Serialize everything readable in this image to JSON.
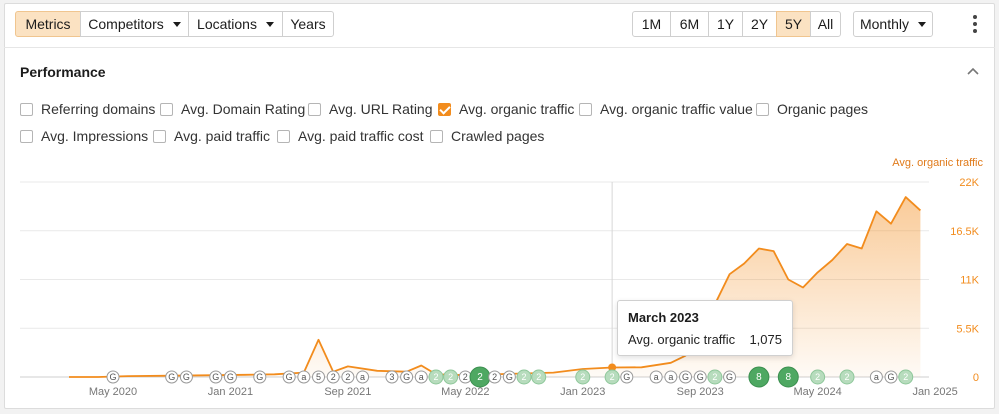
{
  "toolbar": {
    "left_buttons": [
      {
        "label": "Metrics",
        "active": true,
        "dropdown": false
      },
      {
        "label": "Competitors",
        "active": false,
        "dropdown": true
      },
      {
        "label": "Locations",
        "active": false,
        "dropdown": true
      },
      {
        "label": "Years",
        "active": false,
        "dropdown": false
      }
    ],
    "ranges": [
      {
        "label": "1M",
        "active": false
      },
      {
        "label": "6M",
        "active": false
      },
      {
        "label": "1Y",
        "active": false
      },
      {
        "label": "2Y",
        "active": false
      },
      {
        "label": "5Y",
        "active": true
      },
      {
        "label": "All",
        "active": false
      }
    ],
    "interval": "Monthly"
  },
  "section": {
    "title": "Performance"
  },
  "metrics": [
    {
      "label": "Referring domains",
      "checked": false
    },
    {
      "label": "Avg. Domain Rating",
      "checked": false
    },
    {
      "label": "Avg. URL Rating",
      "checked": false
    },
    {
      "label": "Avg. organic traffic",
      "checked": true
    },
    {
      "label": "Avg. organic traffic value",
      "checked": false
    },
    {
      "label": "Organic pages",
      "checked": false
    },
    {
      "label": "Avg. Impressions",
      "checked": false
    },
    {
      "label": "Avg. paid traffic",
      "checked": false
    },
    {
      "label": "Avg. paid traffic cost",
      "checked": false
    },
    {
      "label": "Crawled pages",
      "checked": false
    }
  ],
  "tooltip": {
    "title": "March 2023",
    "metric": "Avg. organic traffic",
    "value": "1,075"
  },
  "colors": {
    "accent": "#f28c1d",
    "active_bg": "#fbe2c2",
    "marker_green": "#4ea862"
  },
  "chart_data": {
    "type": "area",
    "ylabel": "Avg. organic traffic",
    "y_ticks": [
      "0",
      "5.5K",
      "11K",
      "16.5K",
      "22K"
    ],
    "ylim": [
      0,
      22000
    ],
    "x_ticks": [
      "May 2020",
      "Jan 2021",
      "Sep 2021",
      "May 2022",
      "Jan 2023",
      "Sep 2023",
      "May 2024",
      "Jan 2025"
    ],
    "grid": true,
    "series": [
      {
        "name": "Avg. organic traffic",
        "points": [
          [
            "2020-02",
            0
          ],
          [
            "2020-04",
            0
          ],
          [
            "2020-06",
            100
          ],
          [
            "2020-09",
            150
          ],
          [
            "2020-12",
            200
          ],
          [
            "2021-02",
            250
          ],
          [
            "2021-04",
            300
          ],
          [
            "2021-06",
            500
          ],
          [
            "2021-07",
            4200
          ],
          [
            "2021-08",
            600
          ],
          [
            "2021-09",
            1200
          ],
          [
            "2021-11",
            700
          ],
          [
            "2022-01",
            600
          ],
          [
            "2022-02",
            1300
          ],
          [
            "2022-03",
            300
          ],
          [
            "2022-05",
            200
          ],
          [
            "2022-08",
            350
          ],
          [
            "2022-11",
            500
          ],
          [
            "2023-01",
            900
          ],
          [
            "2023-03",
            1075
          ],
          [
            "2023-05",
            1100
          ],
          [
            "2023-07",
            1600
          ],
          [
            "2023-08",
            2400
          ],
          [
            "2023-09",
            4300
          ],
          [
            "2023-10",
            8200
          ],
          [
            "2023-11",
            11600
          ],
          [
            "2023-12",
            12800
          ],
          [
            "2024-01",
            14500
          ],
          [
            "2024-02",
            14200
          ],
          [
            "2024-03",
            11000
          ],
          [
            "2024-04",
            10100
          ],
          [
            "2024-05",
            11800
          ],
          [
            "2024-06",
            13200
          ],
          [
            "2024-07",
            15000
          ],
          [
            "2024-08",
            14500
          ],
          [
            "2024-09",
            18700
          ],
          [
            "2024-10",
            17300
          ],
          [
            "2024-11",
            20300
          ],
          [
            "2024-12",
            18800
          ]
        ]
      }
    ],
    "markers": [
      {
        "date": "2020-05",
        "label": "G",
        "type": "letter"
      },
      {
        "date": "2020-09",
        "label": "G",
        "type": "letter"
      },
      {
        "date": "2020-10",
        "label": "G",
        "type": "letter"
      },
      {
        "date": "2020-12",
        "label": "G",
        "type": "letter"
      },
      {
        "date": "2021-01",
        "label": "G",
        "type": "letter"
      },
      {
        "date": "2021-03",
        "label": "G",
        "type": "letter"
      },
      {
        "date": "2021-05",
        "label": "G",
        "type": "letter"
      },
      {
        "date": "2021-06",
        "label": "a",
        "type": "letter"
      },
      {
        "date": "2021-07",
        "label": "5",
        "type": "letter"
      },
      {
        "date": "2021-08",
        "label": "2",
        "type": "letter"
      },
      {
        "date": "2021-09",
        "label": "2",
        "type": "letter"
      },
      {
        "date": "2021-10",
        "label": "a",
        "type": "letter"
      },
      {
        "date": "2021-12",
        "label": "3",
        "type": "letter"
      },
      {
        "date": "2022-01",
        "label": "G",
        "type": "letter"
      },
      {
        "date": "2022-02",
        "label": "a",
        "type": "letter"
      },
      {
        "date": "2022-03",
        "label": "2",
        "type": "green"
      },
      {
        "date": "2022-04",
        "label": "2",
        "type": "green"
      },
      {
        "date": "2022-05",
        "label": "2",
        "type": "letter"
      },
      {
        "date": "2022-06",
        "label": "2",
        "type": "green-big"
      },
      {
        "date": "2022-07",
        "label": "2",
        "type": "letter"
      },
      {
        "date": "2022-08",
        "label": "G",
        "type": "letter"
      },
      {
        "date": "2022-09",
        "label": "2",
        "type": "green"
      },
      {
        "date": "2022-10",
        "label": "2",
        "type": "green"
      },
      {
        "date": "2023-01",
        "label": "2",
        "type": "green"
      },
      {
        "date": "2023-03",
        "label": "2",
        "type": "green"
      },
      {
        "date": "2023-04",
        "label": "G",
        "type": "letter"
      },
      {
        "date": "2023-06",
        "label": "a",
        "type": "letter"
      },
      {
        "date": "2023-07",
        "label": "a",
        "type": "letter"
      },
      {
        "date": "2023-08",
        "label": "G",
        "type": "letter"
      },
      {
        "date": "2023-09",
        "label": "G",
        "type": "letter"
      },
      {
        "date": "2023-10",
        "label": "2",
        "type": "green"
      },
      {
        "date": "2023-11",
        "label": "G",
        "type": "letter"
      },
      {
        "date": "2024-01",
        "label": "8",
        "type": "green-big"
      },
      {
        "date": "2024-03",
        "label": "8",
        "type": "green-big"
      },
      {
        "date": "2024-05",
        "label": "2",
        "type": "green"
      },
      {
        "date": "2024-07",
        "label": "2",
        "type": "green"
      },
      {
        "date": "2024-09",
        "label": "a",
        "type": "letter"
      },
      {
        "date": "2024-10",
        "label": "G",
        "type": "letter"
      },
      {
        "date": "2024-11",
        "label": "2",
        "type": "green"
      }
    ]
  }
}
